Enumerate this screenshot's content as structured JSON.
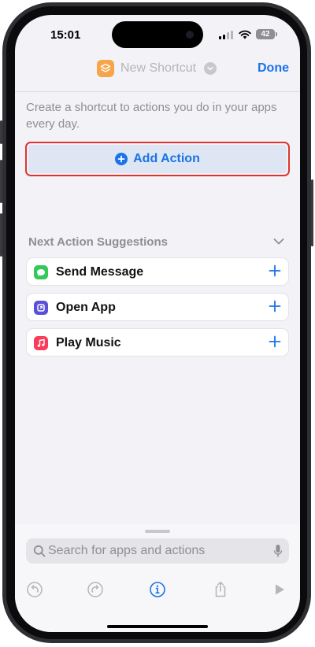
{
  "status_bar": {
    "time": "15:01",
    "battery": "42"
  },
  "nav": {
    "title": "New Shortcut",
    "done_label": "Done"
  },
  "intro_text": "Create a shortcut to actions you do in your apps every day.",
  "add_action": {
    "label": "Add Action"
  },
  "suggestions": {
    "header": "Next Action Suggestions",
    "items": [
      {
        "label": "Send Message",
        "icon": "messages-icon",
        "color": "#34c759"
      },
      {
        "label": "Open App",
        "icon": "open-app-icon",
        "color": "#5b4fd6"
      },
      {
        "label": "Play Music",
        "icon": "music-icon",
        "color": "#fa3c5a"
      }
    ]
  },
  "search": {
    "placeholder": "Search for apps and actions"
  },
  "toolbar": {
    "icons": [
      "undo-icon",
      "redo-icon",
      "info-icon",
      "share-icon",
      "play-icon"
    ]
  },
  "colors": {
    "accent": "#1a73e8",
    "highlight": "#e0352f",
    "app_icon": "#f7a54a"
  }
}
